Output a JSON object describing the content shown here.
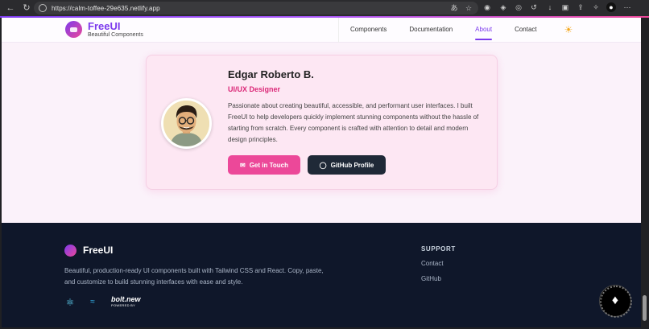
{
  "browser": {
    "url": "https://calm-toffee-29e635.netlify.app",
    "icons": [
      "back-icon",
      "reload-icon",
      "lock-icon",
      "translate-icon",
      "star-icon",
      "extension-icons",
      "profile-icon",
      "menu-icon"
    ]
  },
  "header": {
    "brand": "FreeUI",
    "tagline": "Beautiful Components",
    "nav": [
      {
        "label": "Components",
        "active": false
      },
      {
        "label": "Documentation",
        "active": false
      },
      {
        "label": "About",
        "active": true
      },
      {
        "label": "Contact",
        "active": false
      }
    ],
    "theme_icon": "sun-icon"
  },
  "profile": {
    "name": "Edgar Roberto B.",
    "role": "UI/UX Designer",
    "bio": "Passionate about creating beautiful, accessible, and performant user interfaces. I built FreeUI to help developers quickly implement stunning components without the hassle of starting from scratch. Every component is crafted with attention to detail and modern design principles.",
    "primary_button": "Get in Touch",
    "secondary_button": "GitHub Profile"
  },
  "footer": {
    "brand": "FreeUI",
    "description": "Beautiful, production-ready UI components built with Tailwind CSS and React. Copy, paste, and customize to build stunning interfaces with ease and style.",
    "badge_brand": "bolt.new",
    "badge_caption": "POWERED BY",
    "support_heading": "SUPPORT",
    "support_links": [
      "Contact",
      "GitHub"
    ]
  },
  "colors": {
    "accent": "#7c3aed",
    "pink": "#ec4899",
    "footer_bg": "#0f172a",
    "card_bg": "#fde7f3"
  }
}
